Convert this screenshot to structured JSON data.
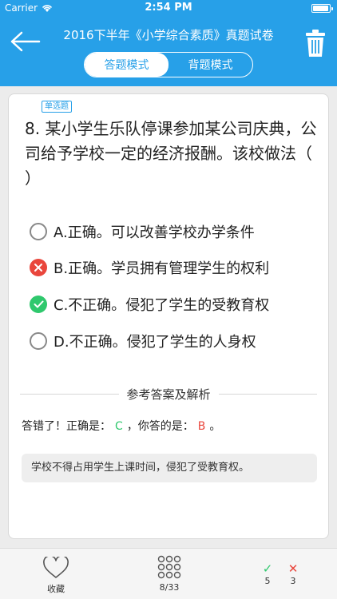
{
  "status": {
    "carrier": "Carrier",
    "time": "2:54 PM"
  },
  "header": {
    "title": "2016下半年《小学综合素质》真题试卷"
  },
  "modes": {
    "answer": "答题模式",
    "recite": "背题模式"
  },
  "question": {
    "type_badge": "单选题",
    "text": "8. 某小学生乐队停课参加某公司庆典，公司给予学校一定的经济报酬。该校做法（ ）",
    "options": [
      {
        "label": "A.正确。可以改善学校办学条件",
        "state": "neutral"
      },
      {
        "label": "B.正确。学员拥有管理学生的权利",
        "state": "wrong"
      },
      {
        "label": "C.不正确。侵犯了学生的受教育权",
        "state": "right"
      },
      {
        "label": "D.不正确。侵犯了学生的人身权",
        "state": "neutral"
      }
    ]
  },
  "analysis": {
    "heading": "参考答案及解析",
    "result_prefix": "答错了！正确是：",
    "correct": "C",
    "result_middle": "，你答的是：",
    "yours": "B",
    "result_suffix": "。",
    "text": "学校不得占用学生上课时间，侵犯了受教育权。"
  },
  "bottom": {
    "favorite_label": "收藏",
    "progress": "8/33",
    "correct_count": "5",
    "wrong_count": "3"
  },
  "colors": {
    "brand": "#27a0e8",
    "correct": "#2fc86d",
    "wrong": "#e9463c"
  }
}
